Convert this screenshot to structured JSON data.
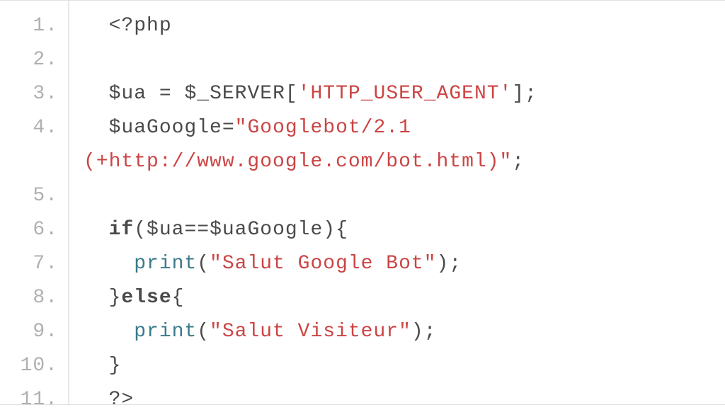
{
  "code": {
    "language": "php",
    "lines": [
      {
        "num": "1.",
        "indent": 1,
        "tokens": [
          {
            "cls": "tok-default",
            "t": "<?php"
          }
        ]
      },
      {
        "num": "2.",
        "indent": 1,
        "tokens": []
      },
      {
        "num": "3.",
        "indent": 1,
        "tokens": [
          {
            "cls": "tok-variable",
            "t": "$ua"
          },
          {
            "cls": "tok-default",
            "t": " "
          },
          {
            "cls": "tok-punct",
            "t": "="
          },
          {
            "cls": "tok-default",
            "t": " "
          },
          {
            "cls": "tok-variable",
            "t": "$_SERVER"
          },
          {
            "cls": "tok-punct",
            "t": "["
          },
          {
            "cls": "tok-string",
            "t": "'HTTP_USER_AGENT'"
          },
          {
            "cls": "tok-punct",
            "t": "]"
          },
          {
            "cls": "tok-punct",
            "t": ";"
          }
        ]
      },
      {
        "num": "4.",
        "indent": 1,
        "wraps": true,
        "tokens": [
          {
            "cls": "tok-variable",
            "t": "$uaGoogle"
          },
          {
            "cls": "tok-punct",
            "t": "="
          },
          {
            "cls": "tok-string",
            "t": "\"Googlebot/2.1 "
          }
        ],
        "wrap_tokens": [
          {
            "cls": "tok-string",
            "t": "(+http://www.google.com/bot.html)\""
          },
          {
            "cls": "tok-punct",
            "t": ";"
          }
        ]
      },
      {
        "num": "5.",
        "indent": 1,
        "tokens": []
      },
      {
        "num": "6.",
        "indent": 1,
        "tokens": [
          {
            "cls": "tok-keyword",
            "t": "if"
          },
          {
            "cls": "tok-punct",
            "t": "("
          },
          {
            "cls": "tok-variable",
            "t": "$ua"
          },
          {
            "cls": "tok-punct",
            "t": "=="
          },
          {
            "cls": "tok-variable",
            "t": "$uaGoogle"
          },
          {
            "cls": "tok-punct",
            "t": ")"
          },
          {
            "cls": "tok-punct",
            "t": "{"
          }
        ]
      },
      {
        "num": "7.",
        "indent": 2,
        "tokens": [
          {
            "cls": "tok-function",
            "t": "print"
          },
          {
            "cls": "tok-punct",
            "t": "("
          },
          {
            "cls": "tok-string",
            "t": "\"Salut Google Bot\""
          },
          {
            "cls": "tok-punct",
            "t": ")"
          },
          {
            "cls": "tok-punct",
            "t": ";"
          }
        ]
      },
      {
        "num": "8.",
        "indent": 1,
        "tokens": [
          {
            "cls": "tok-punct",
            "t": "}"
          },
          {
            "cls": "tok-keyword",
            "t": "else"
          },
          {
            "cls": "tok-punct",
            "t": "{"
          }
        ]
      },
      {
        "num": "9.",
        "indent": 2,
        "tokens": [
          {
            "cls": "tok-function",
            "t": "print"
          },
          {
            "cls": "tok-punct",
            "t": "("
          },
          {
            "cls": "tok-string",
            "t": "\"Salut Visiteur\""
          },
          {
            "cls": "tok-punct",
            "t": ")"
          },
          {
            "cls": "tok-punct",
            "t": ";"
          }
        ]
      },
      {
        "num": "10.",
        "indent": 1,
        "tokens": [
          {
            "cls": "tok-punct",
            "t": "}"
          }
        ]
      },
      {
        "num": "11.",
        "indent": 1,
        "tokens": [
          {
            "cls": "tok-default",
            "t": "?>"
          }
        ]
      }
    ]
  }
}
